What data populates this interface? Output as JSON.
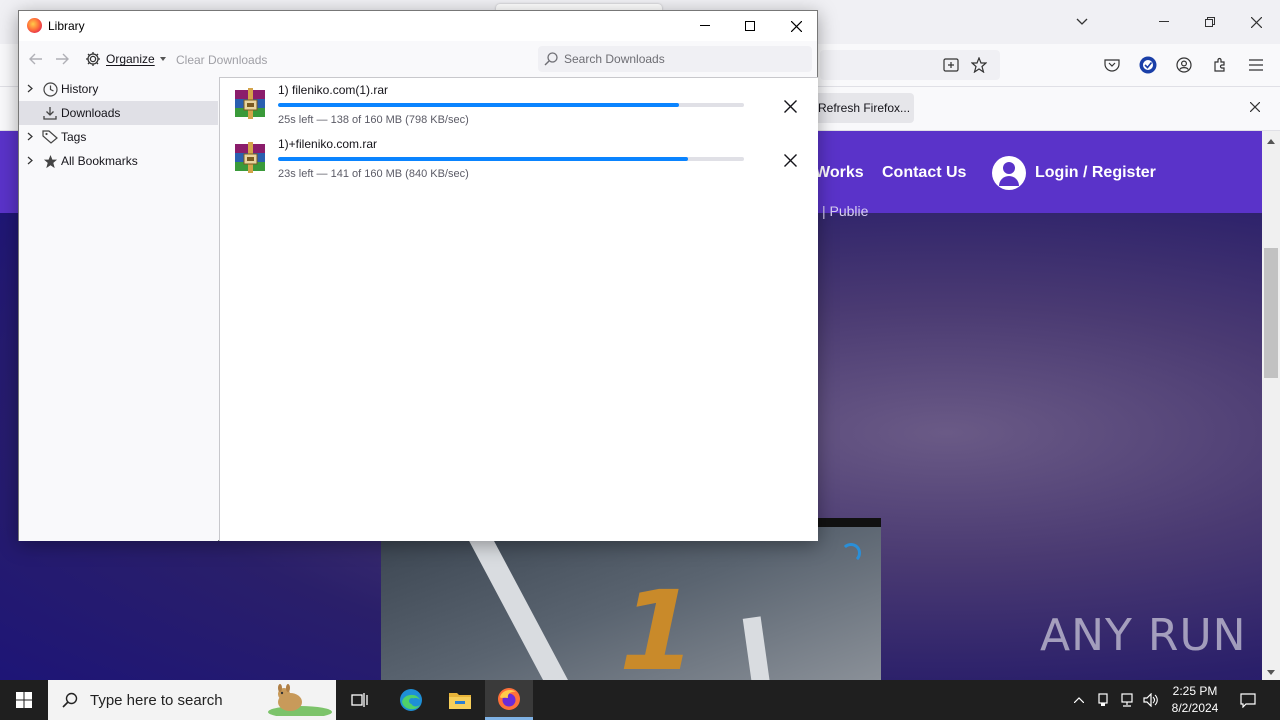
{
  "browser": {
    "notification": {
      "refresh_button": "Refresh Firefox..."
    },
    "site": {
      "nav_works": "Works",
      "nav_contact": "Contact Us",
      "nav_login": "Login / Register",
      "subtext": "| Publie",
      "video_digit": "1"
    },
    "watermark": "ANY RUN"
  },
  "library": {
    "title": "Library",
    "toolbar": {
      "organize_label": "Organize",
      "clear_downloads_label": "Clear Downloads",
      "search_placeholder": "Search Downloads"
    },
    "sidebar": {
      "items": [
        {
          "label": "History",
          "icon": "clock-icon"
        },
        {
          "label": "Downloads",
          "icon": "download-icon",
          "selected": true
        },
        {
          "label": "Tags",
          "icon": "tag-icon"
        },
        {
          "label": "All Bookmarks",
          "icon": "star-icon"
        }
      ]
    },
    "downloads": [
      {
        "filename": "1) fileniko.com(1).rar",
        "status": "25s left — 138 of 160 MB (798 KB/sec)",
        "progress": 0.86
      },
      {
        "filename": "1)+fileniko.com.rar",
        "status": "23s left — 141 of 160 MB (840 KB/sec)",
        "progress": 0.88
      }
    ]
  },
  "taskbar": {
    "search_placeholder": "Type here to search",
    "time": "2:25 PM",
    "date": "8/2/2024"
  },
  "colors": {
    "site_nav": "#5a33c9",
    "progress": "#0a84ff",
    "taskbar": "#1f1f1f"
  }
}
